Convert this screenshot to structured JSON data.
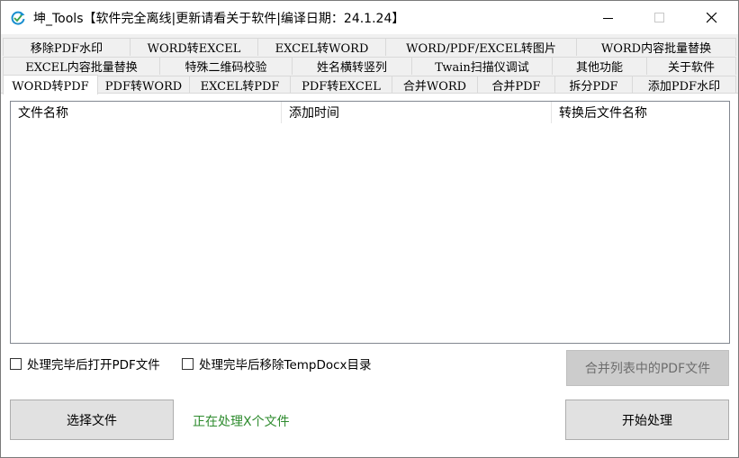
{
  "window": {
    "title": "坤_Tools【软件完全离线|更新请看关于软件|编译日期：24.1.24】",
    "icon": "refresh-arrows-icon"
  },
  "tabs": {
    "row1": [
      "移除PDF水印",
      "WORD转EXCEL",
      "EXCEL转WORD",
      "WORD/PDF/EXCEL转图片",
      "WORD内容批量替换"
    ],
    "row2": [
      "EXCEL内容批量替换",
      "特殊二维码校验",
      "姓名横转竖列",
      "Twain扫描仪调试",
      "其他功能",
      "关于软件"
    ],
    "row3": [
      "WORD转PDF",
      "PDF转WORD",
      "EXCEL转PDF",
      "PDF转EXCEL",
      "合并WORD",
      "合并PDF",
      "拆分PDF",
      "添加PDF水印"
    ],
    "active": "WORD转PDF"
  },
  "list": {
    "columns": [
      "文件名称",
      "添加时间",
      "转换后文件名称"
    ],
    "rows": []
  },
  "options": {
    "open_after": "处理完毕后打开PDF文件",
    "remove_temp": "处理完毕后移除TempDocx目录"
  },
  "buttons": {
    "merge": "合并列表中的PDF文件",
    "select": "选择文件",
    "start": "开始处理"
  },
  "status_text": "正在处理X个文件",
  "colors": {
    "status": "#2e8b2e",
    "icon_accent": "#1a8fd0"
  }
}
